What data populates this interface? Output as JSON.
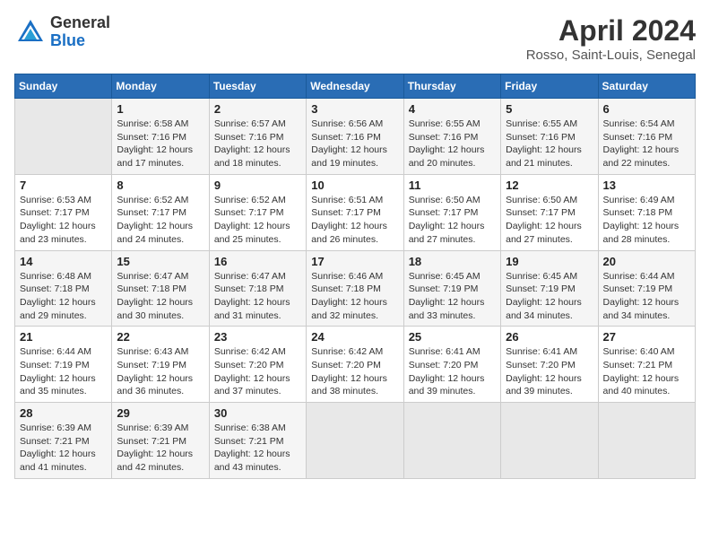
{
  "header": {
    "logo_general": "General",
    "logo_blue": "Blue",
    "month": "April 2024",
    "location": "Rosso, Saint-Louis, Senegal"
  },
  "days_of_week": [
    "Sunday",
    "Monday",
    "Tuesday",
    "Wednesday",
    "Thursday",
    "Friday",
    "Saturday"
  ],
  "weeks": [
    [
      {
        "day": "",
        "info": ""
      },
      {
        "day": "1",
        "info": "Sunrise: 6:58 AM\nSunset: 7:16 PM\nDaylight: 12 hours\nand 17 minutes."
      },
      {
        "day": "2",
        "info": "Sunrise: 6:57 AM\nSunset: 7:16 PM\nDaylight: 12 hours\nand 18 minutes."
      },
      {
        "day": "3",
        "info": "Sunrise: 6:56 AM\nSunset: 7:16 PM\nDaylight: 12 hours\nand 19 minutes."
      },
      {
        "day": "4",
        "info": "Sunrise: 6:55 AM\nSunset: 7:16 PM\nDaylight: 12 hours\nand 20 minutes."
      },
      {
        "day": "5",
        "info": "Sunrise: 6:55 AM\nSunset: 7:16 PM\nDaylight: 12 hours\nand 21 minutes."
      },
      {
        "day": "6",
        "info": "Sunrise: 6:54 AM\nSunset: 7:16 PM\nDaylight: 12 hours\nand 22 minutes."
      }
    ],
    [
      {
        "day": "7",
        "info": "Sunrise: 6:53 AM\nSunset: 7:17 PM\nDaylight: 12 hours\nand 23 minutes."
      },
      {
        "day": "8",
        "info": "Sunrise: 6:52 AM\nSunset: 7:17 PM\nDaylight: 12 hours\nand 24 minutes."
      },
      {
        "day": "9",
        "info": "Sunrise: 6:52 AM\nSunset: 7:17 PM\nDaylight: 12 hours\nand 25 minutes."
      },
      {
        "day": "10",
        "info": "Sunrise: 6:51 AM\nSunset: 7:17 PM\nDaylight: 12 hours\nand 26 minutes."
      },
      {
        "day": "11",
        "info": "Sunrise: 6:50 AM\nSunset: 7:17 PM\nDaylight: 12 hours\nand 27 minutes."
      },
      {
        "day": "12",
        "info": "Sunrise: 6:50 AM\nSunset: 7:17 PM\nDaylight: 12 hours\nand 27 minutes."
      },
      {
        "day": "13",
        "info": "Sunrise: 6:49 AM\nSunset: 7:18 PM\nDaylight: 12 hours\nand 28 minutes."
      }
    ],
    [
      {
        "day": "14",
        "info": "Sunrise: 6:48 AM\nSunset: 7:18 PM\nDaylight: 12 hours\nand 29 minutes."
      },
      {
        "day": "15",
        "info": "Sunrise: 6:47 AM\nSunset: 7:18 PM\nDaylight: 12 hours\nand 30 minutes."
      },
      {
        "day": "16",
        "info": "Sunrise: 6:47 AM\nSunset: 7:18 PM\nDaylight: 12 hours\nand 31 minutes."
      },
      {
        "day": "17",
        "info": "Sunrise: 6:46 AM\nSunset: 7:18 PM\nDaylight: 12 hours\nand 32 minutes."
      },
      {
        "day": "18",
        "info": "Sunrise: 6:45 AM\nSunset: 7:19 PM\nDaylight: 12 hours\nand 33 minutes."
      },
      {
        "day": "19",
        "info": "Sunrise: 6:45 AM\nSunset: 7:19 PM\nDaylight: 12 hours\nand 34 minutes."
      },
      {
        "day": "20",
        "info": "Sunrise: 6:44 AM\nSunset: 7:19 PM\nDaylight: 12 hours\nand 34 minutes."
      }
    ],
    [
      {
        "day": "21",
        "info": "Sunrise: 6:44 AM\nSunset: 7:19 PM\nDaylight: 12 hours\nand 35 minutes."
      },
      {
        "day": "22",
        "info": "Sunrise: 6:43 AM\nSunset: 7:19 PM\nDaylight: 12 hours\nand 36 minutes."
      },
      {
        "day": "23",
        "info": "Sunrise: 6:42 AM\nSunset: 7:20 PM\nDaylight: 12 hours\nand 37 minutes."
      },
      {
        "day": "24",
        "info": "Sunrise: 6:42 AM\nSunset: 7:20 PM\nDaylight: 12 hours\nand 38 minutes."
      },
      {
        "day": "25",
        "info": "Sunrise: 6:41 AM\nSunset: 7:20 PM\nDaylight: 12 hours\nand 39 minutes."
      },
      {
        "day": "26",
        "info": "Sunrise: 6:41 AM\nSunset: 7:20 PM\nDaylight: 12 hours\nand 39 minutes."
      },
      {
        "day": "27",
        "info": "Sunrise: 6:40 AM\nSunset: 7:21 PM\nDaylight: 12 hours\nand 40 minutes."
      }
    ],
    [
      {
        "day": "28",
        "info": "Sunrise: 6:39 AM\nSunset: 7:21 PM\nDaylight: 12 hours\nand 41 minutes."
      },
      {
        "day": "29",
        "info": "Sunrise: 6:39 AM\nSunset: 7:21 PM\nDaylight: 12 hours\nand 42 minutes."
      },
      {
        "day": "30",
        "info": "Sunrise: 6:38 AM\nSunset: 7:21 PM\nDaylight: 12 hours\nand 43 minutes."
      },
      {
        "day": "",
        "info": ""
      },
      {
        "day": "",
        "info": ""
      },
      {
        "day": "",
        "info": ""
      },
      {
        "day": "",
        "info": ""
      }
    ]
  ]
}
